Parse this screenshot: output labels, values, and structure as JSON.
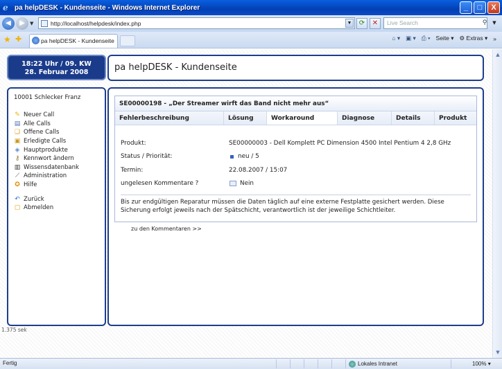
{
  "window": {
    "title": "pa helpDESK - Kundenseite - Windows Internet Explorer",
    "buttons": [
      "_",
      "□",
      "X"
    ]
  },
  "addressbar": {
    "url": "http://localhost/helpdesk/index.php",
    "search_placeholder": "Live Search"
  },
  "tabs": {
    "active_label": "pa helpDESK - Kundenseite"
  },
  "toolbar": {
    "seite_label": "Seite",
    "extras_label": "Extras"
  },
  "page": {
    "clock_line1": "18:22 Uhr / 09. KW",
    "clock_line2": "28. Februar 2008",
    "header_title": "pa helpDESK - Kundenseite",
    "user": "10001 Schlecker Franz",
    "nav": [
      {
        "label": "Neuer Call",
        "icon": "lightbulb-icon"
      },
      {
        "label": "Alle Calls",
        "icon": "list-icon"
      },
      {
        "label": "Offene Calls",
        "icon": "folder-open-icon"
      },
      {
        "label": "Erledigte Calls",
        "icon": "lock-icon"
      },
      {
        "label": "Hauptprodukte",
        "icon": "tag-icon"
      },
      {
        "label": "Kennwort ändern",
        "icon": "key-icon"
      },
      {
        "label": "Wissensdatenbank",
        "icon": "books-icon"
      },
      {
        "label": "Administration",
        "icon": "wrench-icon"
      },
      {
        "label": "Hilfe",
        "icon": "help-icon"
      }
    ],
    "nav2": [
      {
        "label": "Zurück",
        "icon": "back-arrow-icon"
      },
      {
        "label": "Abmelden",
        "icon": "logout-icon"
      }
    ],
    "call_caption": "SE00000198 - „Der Streamer wirft das Band nicht mehr aus“",
    "call_tabs": [
      "Fehlerbeschreibung",
      "Lösung",
      "Workaround",
      "Diagnose",
      "Details",
      "Produkt"
    ],
    "fields": {
      "produkt_label": "Produkt:",
      "produkt_value": "SE00000003 - Dell Komplett PC Dimension 4500 Intel Pentium 4 2,8 GHz",
      "status_label": "Status / Priorität:",
      "status_value": "neu / 5",
      "termin_label": "Termin:",
      "termin_value": "22.08.2007 / 15:07",
      "kommentare_label": "ungelesen Kommentare ?",
      "kommentare_value": "Nein"
    },
    "description": "Bis zur endgültigen Reparatur müssen die Daten täglich auf eine externe Festplatte gesichert werden. Diese Sicherung erfolgt jeweils nach der Spätschicht, verantwortlich ist der jeweilige Schichtleiter.",
    "comments_link": "zu den Kommentaren >>",
    "timer": "1.375 sek"
  },
  "statusbar": {
    "status": "Fertig",
    "zone": "Lokales Intranet",
    "zoom": "100%"
  },
  "colors": {
    "accent": "#1c3d8e",
    "clock_bg": "#1a3a8a"
  }
}
